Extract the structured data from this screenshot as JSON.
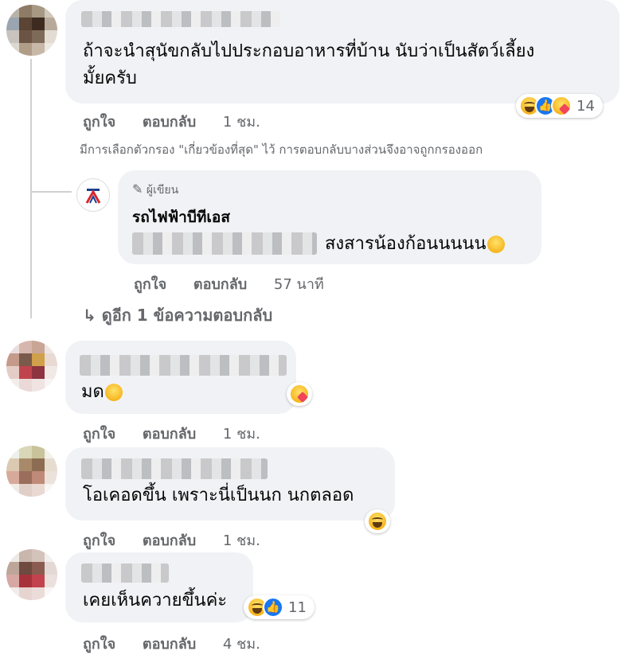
{
  "comments": [
    {
      "text_line1": "ถ้าจะนำสุนัขกลับไปประกอบอาหารที่บ้าน นับว่าเป็นสัตว์เลี้ยง",
      "text_line2": "มั้ยครับ",
      "reaction_count": "14",
      "reaction_icons": [
        "haha-icon",
        "like-icon",
        "care-icon"
      ],
      "actions": {
        "like": "ถูกใจ",
        "reply": "ตอบกลับ",
        "time": "1 ชม."
      }
    },
    {
      "text": "มด",
      "reaction_icons": [
        "care-icon"
      ],
      "actions": {
        "like": "ถูกใจ",
        "reply": "ตอบกลับ",
        "time": "1 ชม."
      }
    },
    {
      "text": "โอเคอดขึ้น เพราะนี่เป็นนก นกตลอด",
      "reaction_icons": [
        "haha-icon"
      ],
      "actions": {
        "like": "ถูกใจ",
        "reply": "ตอบกลับ",
        "time": "1 ชม."
      }
    },
    {
      "text": "เคยเห็นควายขึ้นค่ะ",
      "reaction_count": "11",
      "reaction_icons": [
        "haha-icon",
        "like-icon"
      ],
      "actions": {
        "like": "ถูกใจ",
        "reply": "ตอบกลับ",
        "time": "4 ชม."
      }
    }
  ],
  "filter_notice": "มีการเลือกตัวกรอง \"เกี่ยวข้องที่สุด\" ไว้ การตอบกลับบางส่วนจึงอาจถูกกรองออก",
  "reply": {
    "author_badge": "ผู้เขียน",
    "author_name": "รถไฟฟ้าบีทีเอส",
    "text": "สงสารน้องก้อนนนนน",
    "actions": {
      "like": "ถูกใจ",
      "reply": "ตอบกลับ",
      "time": "57 นาที"
    }
  },
  "more_replies": "ดูอีก 1 ข้อความตอบกลับ",
  "colors": {
    "bubble": "#f0f2f5",
    "meta": "#65676b",
    "like_blue": "#1877f2"
  }
}
